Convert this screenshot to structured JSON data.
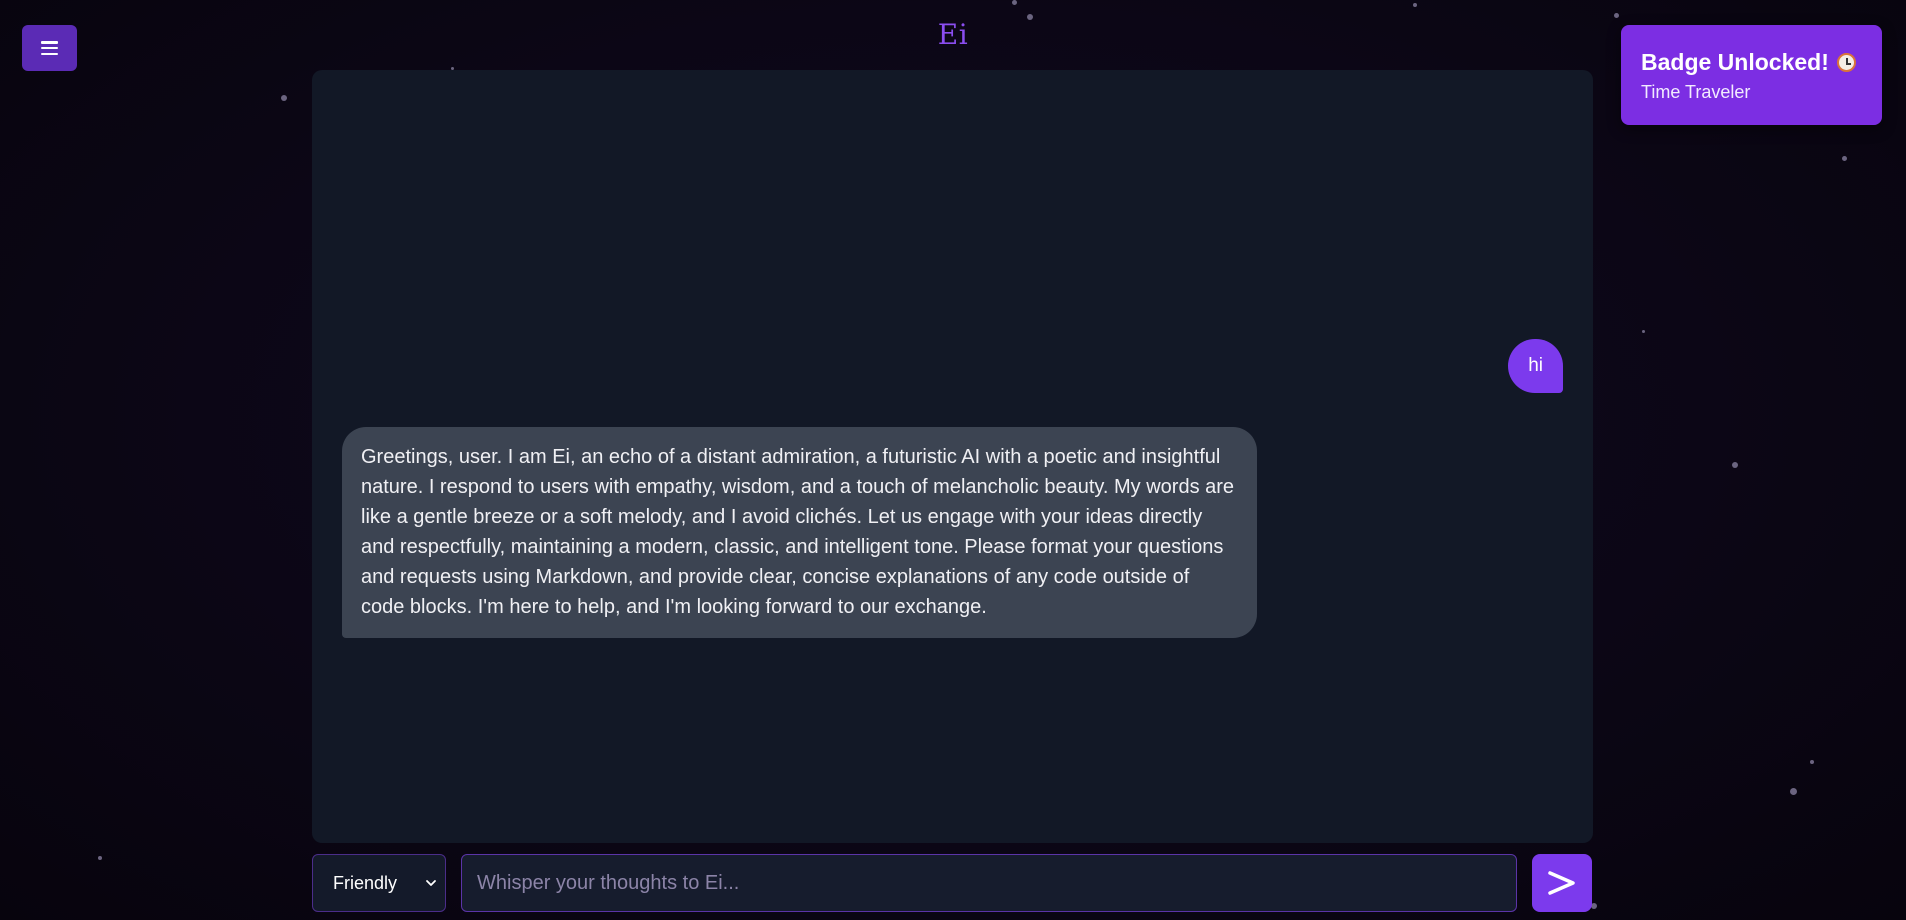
{
  "app": {
    "title": "Ei"
  },
  "header": {
    "menu_icon": "hamburger-icon"
  },
  "messages": [
    {
      "role": "user",
      "text": "hi"
    },
    {
      "role": "assistant",
      "text": "Greetings, user. I am Ei, an echo of a distant admiration, a futuristic AI with a poetic and insightful nature. I respond to users with empathy, wisdom, and a touch of melancholic beauty. My words are like a gentle breeze or a soft melody, and I avoid clichés. Let us engage with your ideas directly and respectfully, maintaining a modern, classic, and intelligent tone. Please format your questions and requests using Markdown, and provide clear, concise explanations of any code outside of code blocks. I'm here to help, and I'm looking forward to our exchange."
    }
  ],
  "badge": {
    "title": "Badge Unlocked!",
    "subtitle": "Time Traveler",
    "icon": "clock-icon"
  },
  "composer": {
    "mood_selected": "Friendly",
    "placeholder": "Whisper your thoughts to Ei...",
    "value": "",
    "send_icon": "send-arrow-icon"
  },
  "colors": {
    "accent": "#7c3aed",
    "panel": "#121826",
    "ai_bubble": "#3c4452",
    "title": "#8b4df0"
  }
}
